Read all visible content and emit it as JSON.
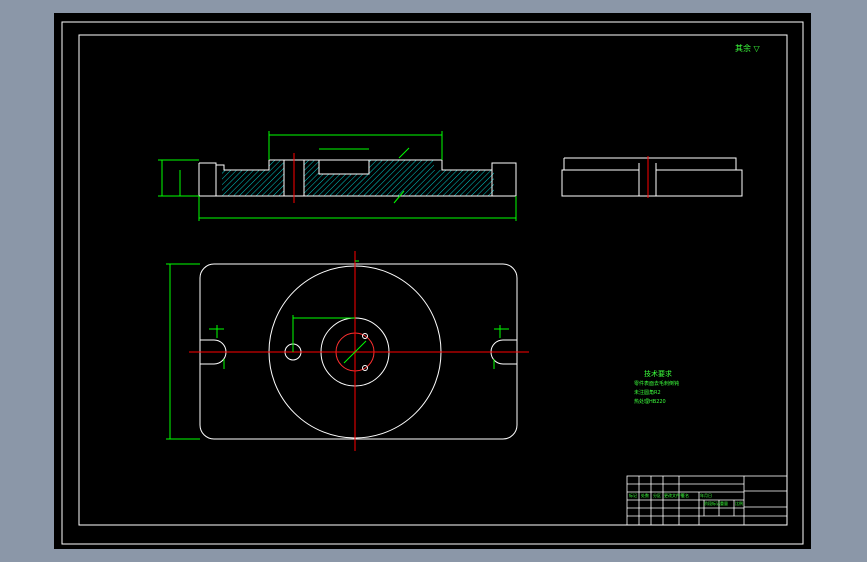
{
  "drawing": {
    "roughness_note": "其余 ▽",
    "technical_requirements": {
      "title": "技术要求",
      "items": [
        "零件表面去毛刺倒钝",
        "未注圆角R2",
        "热处理HB220"
      ]
    },
    "title_block": {
      "row_labels": [
        "标记",
        "处数",
        "分区",
        "更改文件号",
        "签名",
        "年月日"
      ],
      "fields": [
        "阶段标记",
        "重量",
        "比例"
      ]
    },
    "colors": {
      "background": "#000000",
      "outline": "#ffffff",
      "dimension": "#00ff00",
      "centerline": "#ff0000",
      "hatch": "#00c8c8"
    }
  }
}
